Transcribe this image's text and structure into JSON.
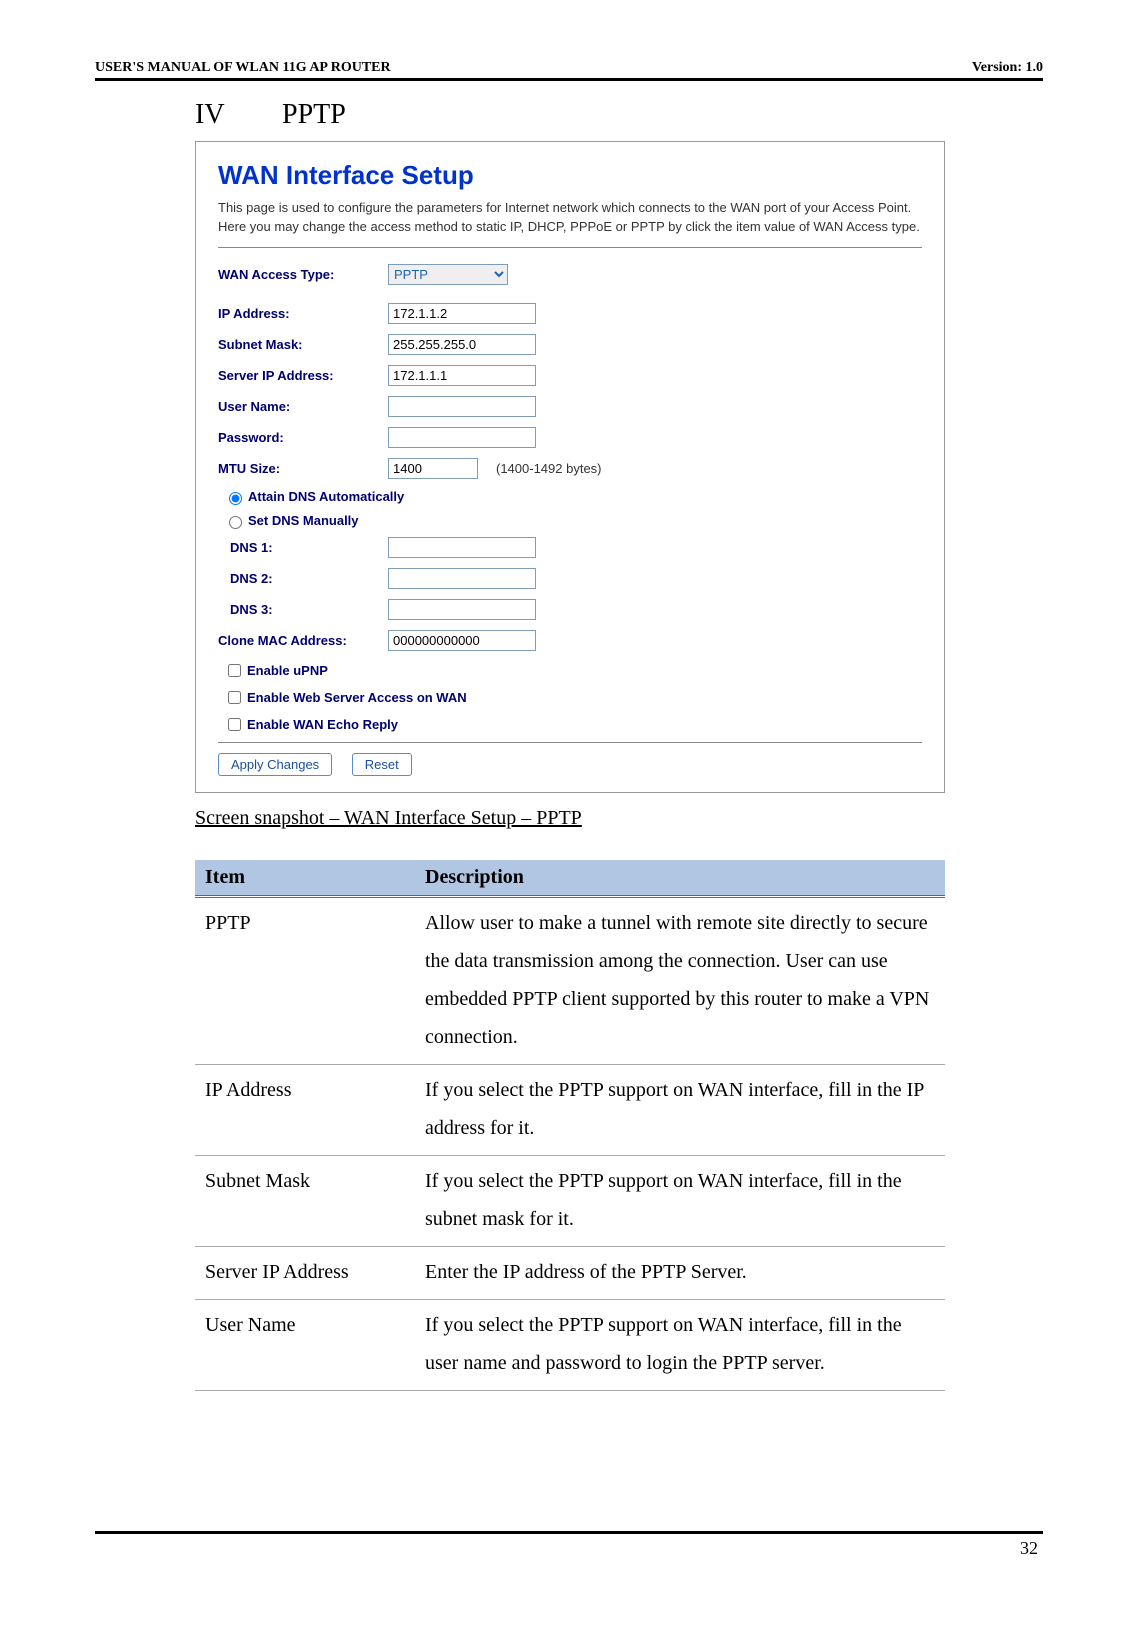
{
  "header": {
    "left": "USER'S MANUAL OF WLAN 11G AP ROUTER",
    "right": "Version: 1.0"
  },
  "section": {
    "roman": "IV",
    "title": "PPTP"
  },
  "wan": {
    "title": "WAN Interface Setup",
    "desc": "This page is used to configure the parameters for Internet network which connects to the WAN port of your Access Point. Here you may change the access method to static IP, DHCP, PPPoE or PPTP by click the item value of WAN Access type.",
    "access_type_label": "WAN Access Type:",
    "access_type_value": "PPTP",
    "ip_label": "IP Address:",
    "ip_value": "172.1.1.2",
    "subnet_label": "Subnet Mask:",
    "subnet_value": "255.255.255.0",
    "server_ip_label": "Server IP Address:",
    "server_ip_value": "172.1.1.1",
    "user_label": "User Name:",
    "user_value": "",
    "pass_label": "Password:",
    "pass_value": "",
    "mtu_label": "MTU Size:",
    "mtu_value": "1400",
    "mtu_note": "(1400-1492 bytes)",
    "attain_dns": "Attain DNS Automatically",
    "set_dns": "Set DNS Manually",
    "dns1": "DNS 1:",
    "dns2": "DNS 2:",
    "dns3": "DNS 3:",
    "clone_mac_label": "Clone MAC Address:",
    "clone_mac_value": "000000000000",
    "upnp": "Enable uPNP",
    "webserver": "Enable Web Server Access on WAN",
    "echo": "Enable WAN Echo Reply",
    "apply": "Apply Changes",
    "reset": "Reset"
  },
  "caption": "Screen snapshot – WAN Interface Setup – PPTP",
  "table": {
    "h1": "Item",
    "h2": "Description",
    "rows": [
      {
        "item": "PPTP",
        "desc": "Allow user to make a tunnel with remote site directly to secure the data transmission among the connection. User can use embedded PPTP client supported by this router to make a VPN connection."
      },
      {
        "item": "IP Address",
        "desc": "If you select the PPTP support on WAN interface, fill in the IP address for it."
      },
      {
        "item": "Subnet Mask",
        "desc": "If you select the PPTP support on WAN interface, fill in the subnet mask for it."
      },
      {
        "item": "Server IP Address",
        "desc": "Enter the IP address of the PPTP Server."
      },
      {
        "item": "User Name",
        "desc": "If you select the PPTP support on WAN interface, fill in the user name and password to login the PPTP server."
      }
    ]
  },
  "page_number": "32"
}
